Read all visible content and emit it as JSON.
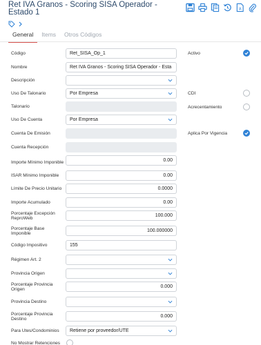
{
  "title": "Ret IVA Granos - Scoring SISA Operador - Estado 1",
  "toolbar": {
    "icons": [
      "save-icon",
      "print-icon",
      "copy-icon",
      "history-icon",
      "document-icon",
      "attach-icon"
    ]
  },
  "tabs": [
    "General",
    "Items",
    "Otros Códigos"
  ],
  "fields": {
    "codigo": {
      "label": "Código",
      "value": "Ret_SISA_Op_1"
    },
    "nombre": {
      "label": "Nombre",
      "value": "Ret IVA Granos - Scoring SISA Operador - Esta"
    },
    "descripcion": {
      "label": "Descripción",
      "value": ""
    },
    "uso_talonario": {
      "label": "Uso De Talonario",
      "value": "Por Empresa"
    },
    "talonario": {
      "label": "Talonario",
      "value": ""
    },
    "uso_cuenta": {
      "label": "Uso De Cuenta",
      "value": "Por Empresa"
    },
    "cuenta_emision": {
      "label": "Cuenta De Emisión",
      "value": ""
    },
    "cuenta_recepcion": {
      "label": "Cuenta Recepción",
      "value": ""
    },
    "importe_minimo": {
      "label": "Importe Mínimo Imponible",
      "value": "0.00"
    },
    "isar_minimo": {
      "label": "ISAR Mínimo Imponible",
      "value": "0.00"
    },
    "limite_precio": {
      "label": "Límite De Precio Unitario",
      "value": "0.0000"
    },
    "importe_acumulado": {
      "label": "Importe Acumulado",
      "value": "0.00"
    },
    "porc_excepcion": {
      "label": "Porcentaje Excepción ReproWeb",
      "value": "100.000"
    },
    "porc_base": {
      "label": "Porcentaje Base Imponible",
      "value": "100.000000"
    },
    "codigo_impositivo": {
      "label": "Código Impositivo",
      "value": "155"
    },
    "regimen": {
      "label": "Régimen Art. 2",
      "value": ""
    },
    "provincia_origen": {
      "label": "Provincia Origen",
      "value": ""
    },
    "porc_prov_origen": {
      "label": "Porcentaje Provincia Origen",
      "value": "0.000"
    },
    "provincia_destino": {
      "label": "Provincia Destino",
      "value": ""
    },
    "porc_prov_destino": {
      "label": "Porcentaje Provincia Destino",
      "value": "0.000"
    },
    "para_utes": {
      "label": "Para Utes/Condominios",
      "value": "Retiene por proveedor/UTE"
    },
    "no_mostrar": {
      "label": "No Mostrar Retenciones"
    }
  },
  "right": {
    "activo": "Activo",
    "cdi": "CDI",
    "acrecentamiento": "Acrecentamiento",
    "aplica_vigencia": "Aplica Por Vigencia"
  },
  "colors": {
    "accent": "#2f82d6",
    "tab_underline": "#d9534f",
    "title": "#2d4a6b"
  }
}
